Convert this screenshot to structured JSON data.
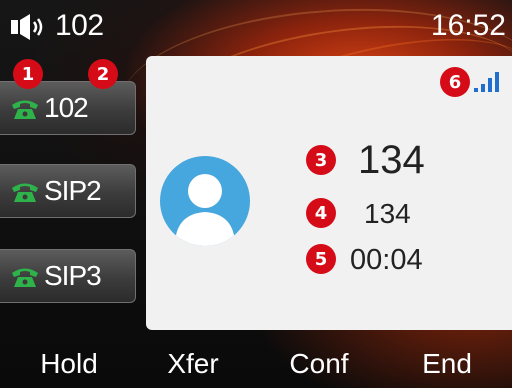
{
  "status_bar": {
    "line_number": "102",
    "time": "16:52",
    "speaker_icon": "speaker-volume-icon"
  },
  "line_keys": [
    {
      "label": "102",
      "icon": "phone-handset-icon",
      "icon_color": "#2db34a"
    },
    {
      "label": "SIP2",
      "icon": "phone-handset-icon",
      "icon_color": "#2db34a"
    },
    {
      "label": "SIP3",
      "icon": "phone-handset-icon",
      "icon_color": "#2db34a"
    }
  ],
  "call": {
    "name": "134",
    "number": "134",
    "duration": "00:04",
    "avatar_icon": "contact-avatar-icon",
    "signal_icon": "signal-strength-icon"
  },
  "callouts": [
    "1",
    "2",
    "3",
    "4",
    "5",
    "6"
  ],
  "softkeys": [
    "Hold",
    "Xfer",
    "Conf",
    "End"
  ],
  "colors": {
    "callout_red": "#d50c17",
    "avatar_blue": "#46a6de",
    "panel_bg": "#f1f1f1",
    "signal_blue": "#1f6fd1"
  }
}
